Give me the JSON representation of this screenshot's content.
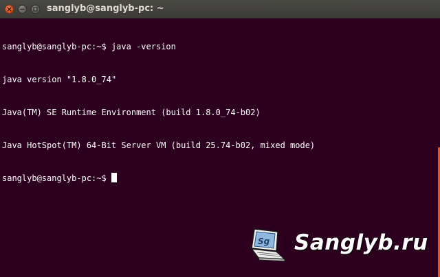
{
  "window": {
    "title": "sanglyb@sanglyb-pc: ~",
    "colors": {
      "background": "#2c001e",
      "titlebar": "#3c3b37",
      "accent": "#e95420",
      "text": "#ffffff"
    }
  },
  "controls": {
    "close_icon": "close-icon",
    "minimize_icon": "minimize-icon",
    "maximize_icon": "maximize-icon"
  },
  "terminal": {
    "lines": [
      "sanglyb@sanglyb-pc:~$ java -version",
      "java version \"1.8.0_74\"",
      "Java(TM) SE Runtime Environment (build 1.8.0_74-b02)",
      "Java HotSpot(TM) 64-Bit Server VM (build 25.74-b02, mixed mode)"
    ],
    "prompt": "sanglyb@sanglyb-pc:~$ "
  },
  "watermark": {
    "logo_text": "Sg",
    "text": "Sanglyb.ru"
  }
}
